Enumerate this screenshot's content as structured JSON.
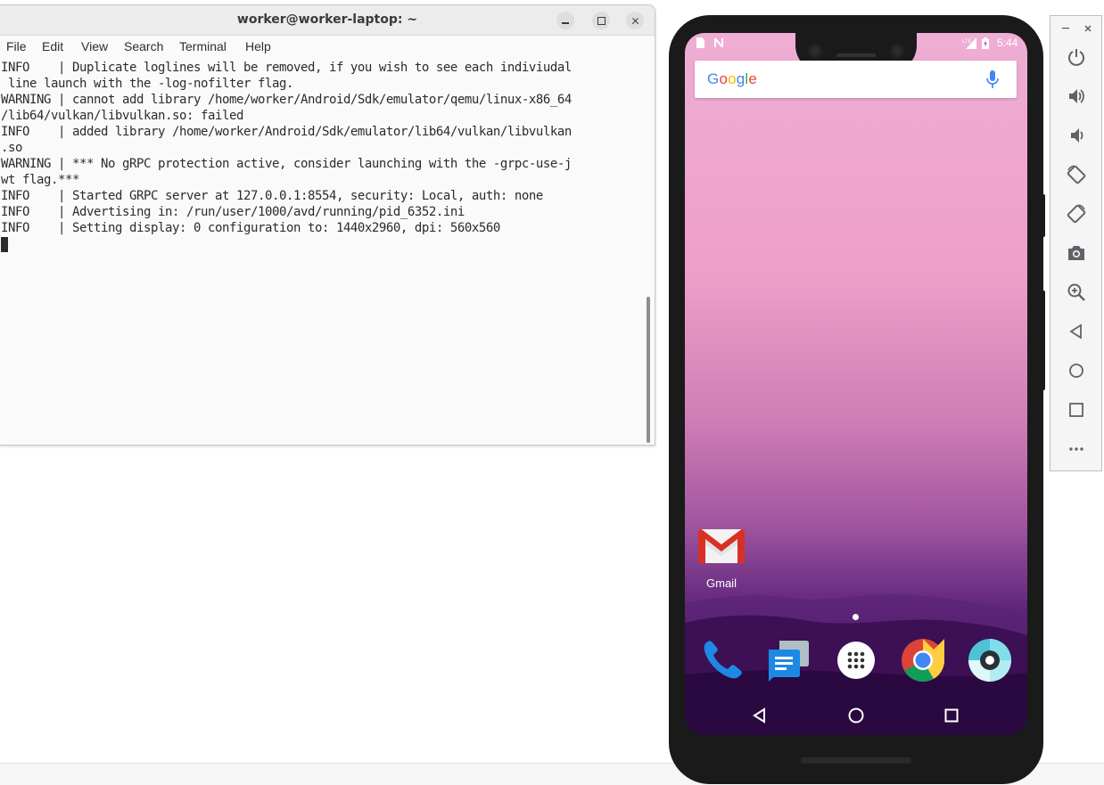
{
  "terminal": {
    "title": "worker@worker-laptop: ~",
    "menu": [
      "File",
      "Edit",
      "View",
      "Search",
      "Terminal",
      "Help"
    ],
    "lines": [
      "INFO    | Duplicate loglines will be removed, if you wish to see each indiviudal",
      " line launch with the -log-nofilter flag.",
      "WARNING | cannot add library /home/worker/Android/Sdk/emulator/qemu/linux-x86_64",
      "/lib64/vulkan/libvulkan.so: failed",
      "INFO    | added library /home/worker/Android/Sdk/emulator/lib64/vulkan/libvulkan",
      ".so",
      "WARNING | *** No gRPC protection active, consider launching with the -grpc-use-j",
      "wt flag.***",
      "INFO    | Started GRPC server at 127.0.0.1:8554, security: Local, auth: none",
      "INFO    | Advertising in: /run/user/1000/avd/running/pid_6352.ini",
      "INFO    | Setting display: 0 configuration to: 1440x2960, dpi: 560x560"
    ]
  },
  "phone": {
    "status": {
      "time": "5:44",
      "icons": [
        "sim-card-icon",
        "n-notification-icon",
        "lte-signal-icon",
        "battery-icon"
      ]
    },
    "search": {
      "logo": [
        "G",
        "o",
        "o",
        "g",
        "l",
        "e"
      ],
      "logo_colors": [
        "#4285F4",
        "#EA4335",
        "#FBBC05",
        "#4285F4",
        "#34A853",
        "#EA4335"
      ],
      "mic_icon": "mic-icon"
    },
    "home_apps": [
      {
        "label": "Gmail",
        "icon": "gmail-icon"
      }
    ],
    "dock": [
      "phone-icon",
      "messages-icon",
      "app-drawer-icon",
      "chrome-icon",
      "camera-icon"
    ],
    "nav": [
      "back-icon",
      "home-icon",
      "recents-icon"
    ]
  },
  "emulator_toolbar": {
    "window_controls": [
      "minimize-icon",
      "close-icon"
    ],
    "buttons": [
      "power-icon",
      "volume-up-icon",
      "volume-down-icon",
      "rotate-left-icon",
      "rotate-right-icon",
      "screenshot-icon",
      "zoom-icon",
      "back-icon",
      "home-icon",
      "overview-icon",
      "more-icon"
    ]
  },
  "colors": {
    "accent_mic": "#4285F4",
    "gmail_red": "#D93025",
    "phone_blue": "#1E88E5"
  }
}
